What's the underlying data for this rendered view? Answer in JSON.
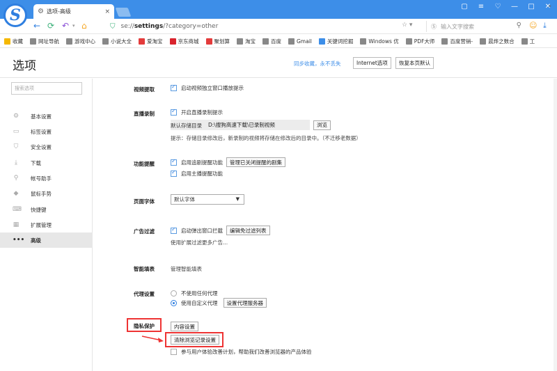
{
  "window": {
    "tab_title": "选项-高级",
    "tab_close": "×",
    "controls": [
      "▢",
      "≡",
      "♡",
      "—",
      "□",
      "✕"
    ]
  },
  "nav": {
    "url_prefix": "se://",
    "url_bold": "settings",
    "url_rest": "/?category=other",
    "search_placeholder": "输入文字搜索"
  },
  "bookmarks": {
    "items": [
      {
        "label": "收藏",
        "color": "#f5b800"
      },
      {
        "label": "网址导航",
        "color": "#888888"
      },
      {
        "label": "游戏中心",
        "color": "#888888"
      },
      {
        "label": "小说大全",
        "color": "#888888"
      },
      {
        "label": "爱淘宝",
        "color": "#e33b3b"
      },
      {
        "label": "京东商城",
        "color": "#d9232d"
      },
      {
        "label": "聚划算",
        "color": "#e33b3b"
      },
      {
        "label": "淘宝",
        "color": "#888888"
      },
      {
        "label": "百度",
        "color": "#888888"
      },
      {
        "label": "Gmail",
        "color": "#888888"
      },
      {
        "label": "关键词挖掘",
        "color": "#3d8ee8"
      },
      {
        "label": "Windows 优",
        "color": "#888888"
      },
      {
        "label": "PDF大师",
        "color": "#888888"
      },
      {
        "label": "百度营销-",
        "color": "#888888"
      },
      {
        "label": "晨烨之数合",
        "color": "#888888"
      },
      {
        "label": "工",
        "color": "#888888"
      }
    ],
    "more": "»"
  },
  "header": {
    "title": "选项",
    "sync_link": "同步收藏，永不丢失",
    "internet_btn": "Internet选项",
    "restore_btn": "恢复本页默认"
  },
  "sidebar": {
    "search_placeholder": "搜索选项",
    "items": [
      {
        "label": "基本设置",
        "icon": "⚙"
      },
      {
        "label": "标签设置",
        "icon": "▭"
      },
      {
        "label": "安全设置",
        "icon": "⛉"
      },
      {
        "label": "下载",
        "icon": "⤓"
      },
      {
        "label": "帐号助手",
        "icon": "⚲"
      },
      {
        "label": "鼠标手势",
        "icon": "◆"
      },
      {
        "label": "快捷键",
        "icon": "⌨"
      },
      {
        "label": "扩展管理",
        "icon": "▦"
      },
      {
        "label": "高级",
        "icon": "•••"
      }
    ]
  },
  "settings": {
    "video": {
      "label": "视频提取",
      "option": "启动视频独立窗口播放提示"
    },
    "live": {
      "label": "直播录制",
      "option": "开启直播录制提示",
      "path_label": "默认存储目录",
      "path_value": "D:\\搜狗高速下载\\已录制视频",
      "browse": "浏览",
      "hint": "提示：存储目录修改后，新录制的视频将存储在修改后的目录中。（不迁移老数据）"
    },
    "remind": {
      "label": "功能提醒",
      "option1": "启用追剧提醒功能",
      "manage_btn": "管理已关闭提醒的剧集",
      "option2": "启用主播提醒功能"
    },
    "font": {
      "label": "页面字体",
      "value": "默认字体"
    },
    "adblock": {
      "label": "广告过滤",
      "option": "启动弹出窗口拦截",
      "edit_btn": "编辑免过滤列表",
      "ext_hint": "使用扩展过滤更多广告..."
    },
    "autofill": {
      "label": "智能填表",
      "link": "管理智能填表"
    },
    "proxy": {
      "label": "代理设置",
      "option_none": "不使用任何代理",
      "option_custom": "使用自定义代理",
      "setup_btn": "设置代理服务器"
    },
    "privacy": {
      "label": "隐私保护",
      "content_btn": "内容设置",
      "clear_btn": "清除浏览记录设置",
      "ux_option": "参与用户体验改善计划，帮助我们改善浏览器的产品体验"
    }
  },
  "colors": {
    "accent": "#3d8ee8",
    "highlight": "#e33333"
  }
}
